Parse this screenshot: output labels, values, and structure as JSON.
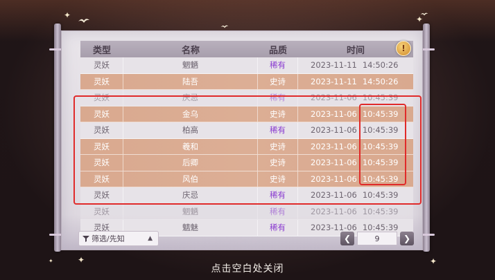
{
  "table": {
    "headers": {
      "type": "类型",
      "name": "名称",
      "quality": "品质",
      "time": "时间"
    },
    "rows": [
      {
        "type": "灵妖",
        "name": "魍魉",
        "quality": "稀有",
        "date": "2023-11-11",
        "clock": "14:50:26",
        "tier": "rare"
      },
      {
        "type": "灵妖",
        "name": "陆吾",
        "quality": "史诗",
        "date": "2023-11-11",
        "clock": "14:50:26",
        "tier": "epic"
      },
      {
        "type": "灵妖",
        "name": "庆忌",
        "quality": "稀有",
        "date": "2023-11-06",
        "clock": "10:45:39",
        "tier": "rare"
      },
      {
        "type": "灵妖",
        "name": "金乌",
        "quality": "史诗",
        "date": "2023-11-06",
        "clock": "10:45:39",
        "tier": "epic"
      },
      {
        "type": "灵妖",
        "name": "柏高",
        "quality": "稀有",
        "date": "2023-11-06",
        "clock": "10:45:39",
        "tier": "rare"
      },
      {
        "type": "灵妖",
        "name": "羲和",
        "quality": "史诗",
        "date": "2023-11-06",
        "clock": "10:45:39",
        "tier": "epic"
      },
      {
        "type": "灵妖",
        "name": "后卿",
        "quality": "史诗",
        "date": "2023-11-06",
        "clock": "10:45:39",
        "tier": "epic"
      },
      {
        "type": "灵妖",
        "name": "风伯",
        "quality": "史诗",
        "date": "2023-11-06",
        "clock": "10:45:39",
        "tier": "epic"
      },
      {
        "type": "灵妖",
        "name": "庆忌",
        "quality": "稀有",
        "date": "2023-11-06",
        "clock": "10:45:39",
        "tier": "rare"
      },
      {
        "type": "灵妖",
        "name": "魍魉",
        "quality": "稀有",
        "date": "2023-11-06",
        "clock": "10:45:39",
        "tier": "rare"
      },
      {
        "type": "灵妖",
        "name": "魑魅",
        "quality": "稀有",
        "date": "2023-11-06",
        "clock": "10:45:39",
        "tier": "rare"
      }
    ]
  },
  "info_button": {
    "icon": "info-icon",
    "glyph": "!"
  },
  "filter": {
    "label": "筛选/先知",
    "icon": "funnel-icon",
    "arrow": "▲"
  },
  "pager": {
    "prev": "❮",
    "next": "❯",
    "page": "9"
  },
  "footer": {
    "close_hint": "点击空白处关闭"
  },
  "colors": {
    "rare_text": "#8a3bd0",
    "epic_row": "#d9a98f",
    "highlight": "#e02a2a"
  }
}
